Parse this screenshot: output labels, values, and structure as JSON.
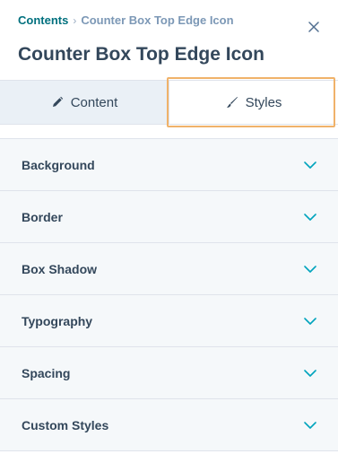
{
  "breadcrumb": {
    "parent": "Contents",
    "separator": "›",
    "current": "Counter Box Top Edge Icon"
  },
  "title": "Counter Box Top Edge Icon",
  "tabs": [
    {
      "label": "Content",
      "icon": "pencil-icon",
      "active": false
    },
    {
      "label": "Styles",
      "icon": "brush-icon",
      "active": true
    }
  ],
  "sections": [
    {
      "label": "Background"
    },
    {
      "label": "Border"
    },
    {
      "label": "Box Shadow"
    },
    {
      "label": "Typography"
    },
    {
      "label": "Spacing"
    },
    {
      "label": "Custom Styles"
    }
  ],
  "colors": {
    "accent": "#00707e",
    "text": "#33475b",
    "highlight": "#f0b26a",
    "section_bg": "#f5f8fa"
  }
}
